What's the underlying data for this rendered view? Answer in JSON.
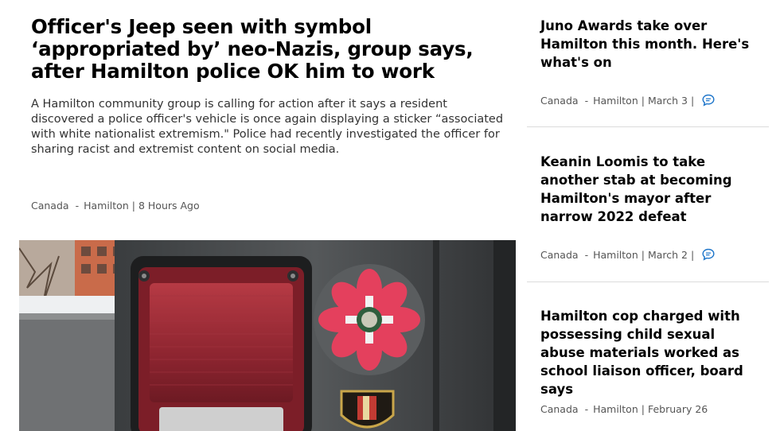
{
  "main_story": {
    "title": "Officer's Jeep seen with symbol ‘appropriated by’ neo-Nazis, group says, after Hamilton police OK him to work",
    "description": "A Hamilton community group is calling for action after it says a resident discovered a police officer's vehicle is once again displaying a sticker “associated with white nationalist extremism.\" Police had recently investigated the officer for sharing racist and extremist content on social media.",
    "meta": {
      "category": "Canada",
      "dash": "-",
      "location": "Hamilton",
      "sep": "|",
      "time": "8 Hours Ago"
    }
  },
  "sidebar": {
    "items": [
      {
        "title": "Juno Awards take over Hamilton this month. Here's what's on",
        "category": "Canada",
        "dash": "-",
        "location": "Hamilton",
        "sep": "|",
        "date": "March 3",
        "sep2": "|",
        "comment_icon": "speech-bubble-icon"
      },
      {
        "title": "Keanin Loomis to take another stab at becoming Hamilton's mayor after narrow 2022 defeat",
        "category": "Canada",
        "dash": "-",
        "location": "Hamilton",
        "sep": "|",
        "date": "March 2",
        "sep2": "|",
        "comment_icon": "speech-bubble-icon"
      },
      {
        "title": "Hamilton cop charged with possessing child sexual abuse materials worked as school liaison officer, board says",
        "category": "Canada",
        "dash": "-",
        "location": "Hamilton",
        "sep": "|",
        "date": "February 26"
      }
    ]
  },
  "colors": {
    "comment_icon": "#1a73c9",
    "divider": "#dcdcdc"
  }
}
